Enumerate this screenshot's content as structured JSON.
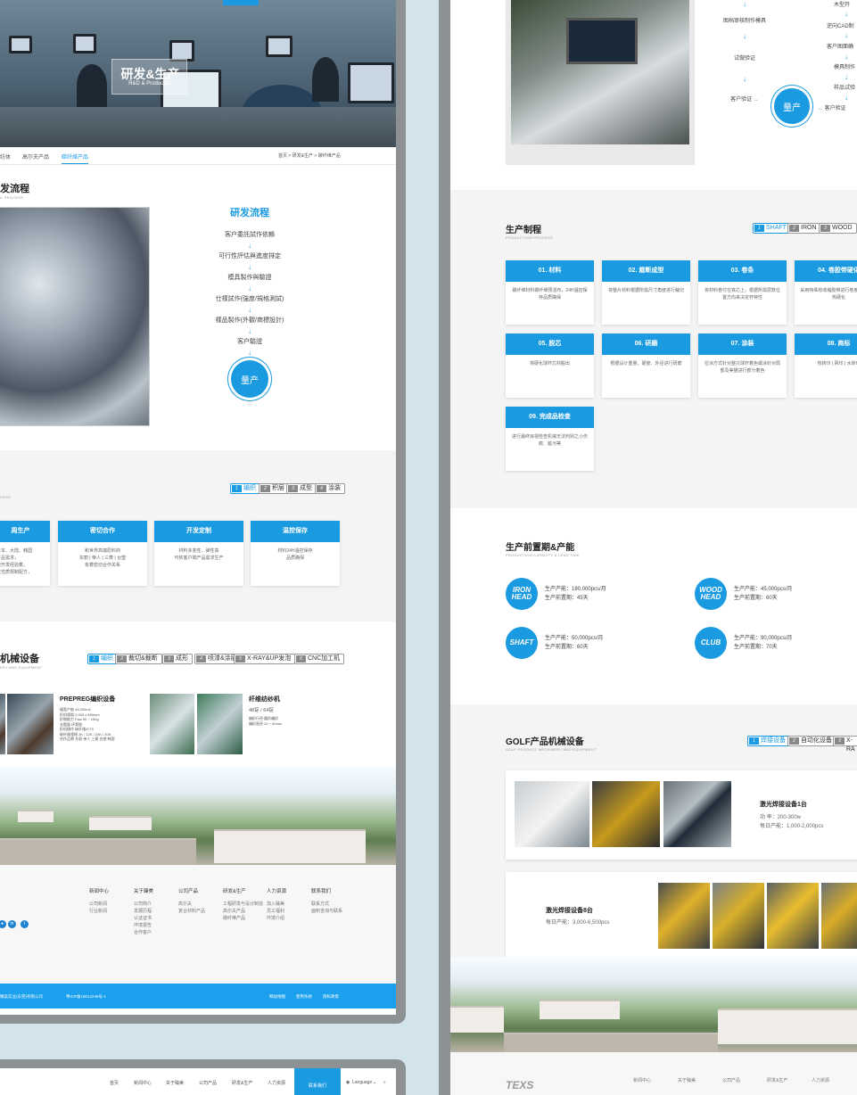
{
  "left": {
    "hero": {
      "title": "研发&生产",
      "subtitle": "R&D & Production"
    },
    "subnav": {
      "items": [
        "纺体",
        "高尔夫产品",
        "碳纤维产品"
      ],
      "active": "碳纤维产品",
      "breadcrumb": "首页 > 研发&生产 > 碳纤维产品"
    },
    "process": {
      "title": "发流程",
      "subtitle": "D PROCESS",
      "flow_title": "研发流程",
      "steps": [
        "客户委託試作依賴",
        "可行性評估與進度排定",
        "模具製作與驗證",
        "仕樣試作(強度/規格測試)",
        "樣品製作(外觀/商標設計)",
        "客户驗證"
      ],
      "final": "量产"
    },
    "materials": {
      "subtitle": "CESS",
      "tabs": [
        {
          "n": "1",
          "label": "编织"
        },
        {
          "n": "2",
          "label": "积层"
        },
        {
          "n": "3",
          "label": "成型"
        },
        {
          "n": "4",
          "label": "涂装"
        }
      ],
      "cards": [
        {
          "title": "周生产",
          "body": "日本、大陆、韩国\n产品需求，\n囊开发经验着，\n优性质规制配方，"
        },
        {
          "title": "密切合作",
          "body": "和世界高端原料商\n东丽 | 帝人 | 三菱 | 台塑\n有着密切合作关系"
        },
        {
          "title": "开发定制",
          "body": "材料多变性、弹性高\n可依客户端产品需求生产"
        },
        {
          "title": "温控保存",
          "body": "材料24H温控保存\n品质确保"
        }
      ]
    },
    "machinery": {
      "title": "机械设备",
      "subtitle": "ERY AND EQUIPMENT",
      "tabs": [
        {
          "n": "1",
          "label": "编织"
        },
        {
          "n": "2",
          "label": "裁切&裁断"
        },
        {
          "n": "3",
          "label": "成形"
        },
        {
          "n": "4",
          "label": "喷漆&涂层"
        },
        {
          "n": "5",
          "label": "X-RAY&UP发泡"
        },
        {
          "n": "6",
          "label": "CNC加工机"
        }
      ],
      "item1": {
        "title": "PREPREG编织设备",
        "spec": "幅宽产能       44,000m2\n织机规格       2,000 x 890mm\n织物能力       Faw 90 ~ 150g\n含脂量         环氧胶\n织机操作       碳纤维/ETS\n碳纤维规格 3K / 12K / 24K / 30K\n合作品牌   东丽 帝人 三菱 台塑 韩国"
      },
      "item2": {
        "title": "纤维纺纱机",
        "sub": "48锭 / 64锭",
        "spec": "编织行径       圆形编织\n编织直径       20 ~ 60mm"
      }
    },
    "footer": {
      "cols": [
        {
          "head": "新闻中心",
          "items": [
            "公司新闻",
            "行业新闻"
          ]
        },
        {
          "head": "关于臻美",
          "items": [
            "公司简介",
            "发展历程",
            "认证证书",
            "环境报告",
            "合作客户"
          ]
        },
        {
          "head": "公司产品",
          "items": [
            "高尔夫",
            "复合材料产品"
          ]
        },
        {
          "head": "研发&生产",
          "items": [
            "工程研发与设计制造",
            "高尔夫产品",
            "碳纤维产品"
          ]
        },
        {
          "head": "人力资源",
          "items": [
            "加入臻美",
            "员工福利",
            "环境介绍"
          ]
        },
        {
          "head": "联系我们",
          "items": [
            "联系方式",
            "面积咨询与联系"
          ]
        }
      ],
      "copyright": "臻美实业(东莞)有限公司",
      "icp": "粤ICP备19014246号-1",
      "links": [
        "网站地图",
        "使用条款",
        "隐私政策"
      ]
    }
  },
  "bottom_nav": {
    "items": [
      "首页",
      "新闻中心",
      "关于臻美",
      "公司产品",
      "研发&生产",
      "人力资源"
    ],
    "active": "联系我们",
    "language": "Language",
    "search_icon": "search-icon"
  },
  "right": {
    "mold_flow": {
      "col1": [
        "图档审核制作模具",
        "试做验证",
        "客户验证"
      ],
      "col2": [
        "木型开",
        "逆向CAD制",
        "客户图面确",
        "模具制作",
        "样品试验",
        "客户验证"
      ],
      "final": "量产"
    },
    "production": {
      "title": "生产制程",
      "subtitle": "PRODUCTION PROCESS",
      "tabs": [
        {
          "n": "1",
          "label": "SHAFT"
        },
        {
          "n": "2",
          "label": "IRON"
        },
        {
          "n": "3",
          "label": "WOOD"
        }
      ],
      "cards": [
        {
          "title": "01. 材料",
          "body": "碳纤维材料碳纤维预浸布，24H温控保存品质确保"
        },
        {
          "title": "02. 裁断成型",
          "body": "将整片材料根据所需尺寸角度进行裁切"
        },
        {
          "title": "03. 卷条",
          "body": "将材料卷付在铁芯上，根据所需层数位置方向来决定杆特性"
        },
        {
          "title": "04. 卷胶带硬化",
          "body": "采用特殊热收缩胶带进行卷度~150度加热硬化"
        },
        {
          "title": "05. 脱芯",
          "body": "将硬化球杆芯材脱出"
        },
        {
          "title": "06. 研磨",
          "body": "根据设计重量、硬度、外径进行研磨"
        },
        {
          "title": "07. 涂装",
          "body": "拉涂方式针对整只球杆着色或涂针对局部及美猫进行部分着色"
        },
        {
          "title": "08. 商标",
          "body": "热转印 | 网印 | 水转印"
        },
        {
          "title": "09. 完成品检查",
          "body": "进行最终目视检查机械无法判别之小伤痕、脏污等"
        }
      ]
    },
    "capacity": {
      "title": "生产前置期&产能",
      "subtitle": "PRODUCTION CAPACITY & LEAD TIME",
      "items": [
        {
          "badge": "IRON HEAD",
          "cap": "生产产能：180,000pcs/月",
          "lead": "生产前置期：45天"
        },
        {
          "badge": "WOOD HEAD",
          "cap": "生产产能：45,000pcs/月",
          "lead": "生产前置期：60天"
        },
        {
          "badge": "SHAFT",
          "cap": "生产产能：50,000pcs/月",
          "lead": "生产前置期：60天"
        },
        {
          "badge": "CLUB",
          "cap": "生产产能：90,000pcs/月",
          "lead": "生产前置期：70天"
        }
      ]
    },
    "golf_equipment": {
      "title": "GOLF产品机械设备",
      "subtitle": "GOLF PRODUCT MECHINERY AND EQUIPMENT",
      "tabs": [
        {
          "n": "1",
          "label": "焊接设备"
        },
        {
          "n": "2",
          "label": "自动化设备"
        },
        {
          "n": "3",
          "label": "X-RA"
        }
      ],
      "item1": {
        "title": "激光焊接设备1台",
        "l1": "功 率：200-300w",
        "l2": "每日产能：1,000-2,000pcs"
      },
      "item2": {
        "title": "激光焊接设备8台",
        "l1": "每日产能：3,000-6,500pcs"
      }
    },
    "footer_cols": [
      "新闻中心",
      "关于臻美",
      "公司产品",
      "研发&生产",
      "人力资源"
    ]
  },
  "colors": {
    "accent": "#1a9ae0",
    "bar": "#1aa0ec",
    "frame": "#8e9194",
    "bg": "#d4e4ec"
  }
}
